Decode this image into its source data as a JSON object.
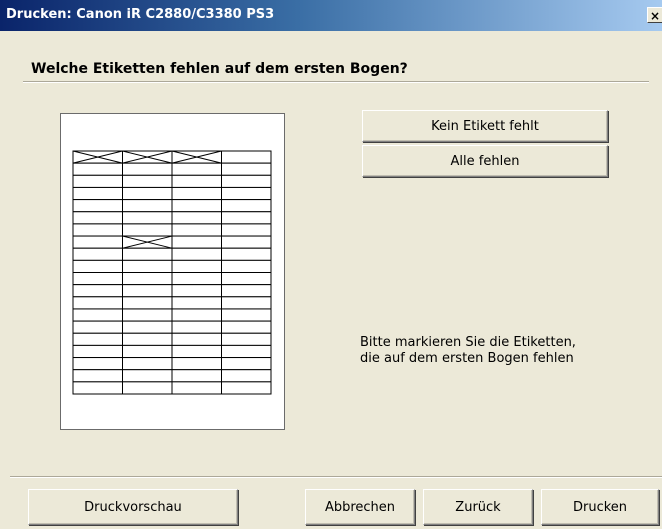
{
  "window": {
    "title": "Drucken: Canon iR C2880/C3380 PS3",
    "close_glyph": "×"
  },
  "heading": "Welche Etiketten fehlen auf dem ersten Bogen?",
  "sheet": {
    "columns": 4,
    "rows": 20,
    "missing_labels": [
      {
        "row": 1,
        "col": 1
      },
      {
        "row": 1,
        "col": 2
      },
      {
        "row": 1,
        "col": 3
      },
      {
        "row": 8,
        "col": 2
      }
    ]
  },
  "buttons": {
    "none_missing": "Kein Etikett fehlt",
    "all_missing": "Alle fehlen",
    "preview": "Druckvorschau",
    "cancel": "Abbrechen",
    "back": "Zurück",
    "print": "Drucken"
  },
  "info": {
    "line1": "Bitte markieren Sie die Etiketten,",
    "line2": "die auf dem ersten Bogen fehlen"
  }
}
